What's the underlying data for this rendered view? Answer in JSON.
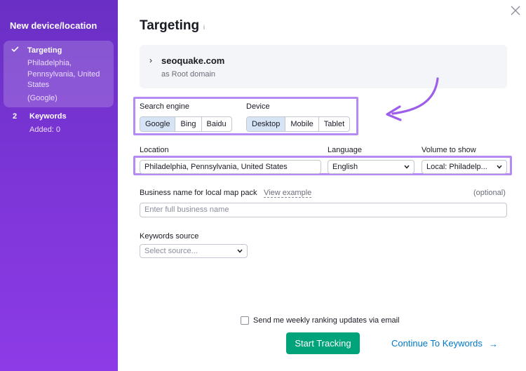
{
  "sidebar": {
    "title": "New device/location",
    "steps": [
      {
        "number": "",
        "title": "Targeting",
        "subtitle": "Philadelphia, Pennsylvania, United States",
        "subtitle2": "(Google)"
      },
      {
        "number": "2",
        "title": "Keywords",
        "subtitle": "Added: 0"
      }
    ]
  },
  "main": {
    "title": "Targeting",
    "info_glyph": "i",
    "domain": {
      "chevron": "›",
      "name": "seoquake.com",
      "type": "as Root domain"
    },
    "search_engine": {
      "label": "Search engine",
      "options": [
        "Google",
        "Bing",
        "Baidu"
      ],
      "selected": "Google"
    },
    "device": {
      "label": "Device",
      "options": [
        "Desktop",
        "Mobile",
        "Tablet"
      ],
      "selected": "Desktop"
    },
    "location": {
      "label": "Location",
      "value": "Philadelphia, Pennsylvania, United States"
    },
    "language": {
      "label": "Language",
      "value": "English"
    },
    "volume": {
      "label": "Volume to show",
      "value": "Local: Philadelp..."
    },
    "business": {
      "label": "Business name for local map pack",
      "link": "View example",
      "optional": "(optional)",
      "placeholder": "Enter full business name"
    },
    "keywords_source": {
      "label": "Keywords source",
      "placeholder": "Select source..."
    },
    "email_updates": {
      "label": "Send me weekly ranking updates via email",
      "checked": false
    },
    "start_button": "Start Tracking",
    "continue_link": "Continue To Keywords",
    "continue_arrow": "→"
  },
  "colors": {
    "sidebar": "#7b35d6",
    "highlight": "#b58af2",
    "primary": "#00a37a",
    "link": "#0078c9",
    "selected_segment": "#d6e4f5"
  },
  "icons": [
    "check-icon",
    "close-icon",
    "info-icon",
    "chevron-right-icon",
    "chevron-down-icon",
    "arrow-right-icon",
    "curved-arrow-icon"
  ]
}
